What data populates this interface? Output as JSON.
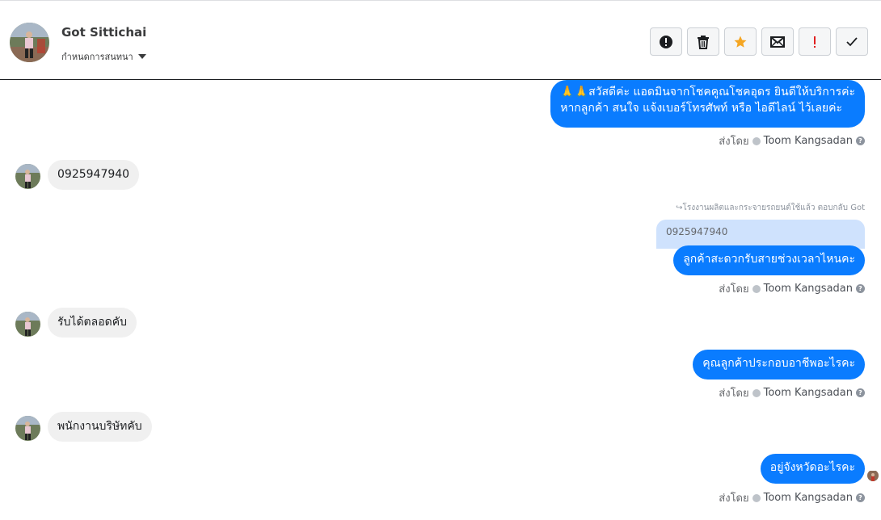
{
  "header": {
    "contact_name": "Got Sittichai",
    "assign_label": "กำหนดการสนทนา"
  },
  "toolbar": {
    "buttons": [
      {
        "name": "alert-circle",
        "icon": "alert-circle-icon"
      },
      {
        "name": "trash",
        "icon": "trash-icon"
      },
      {
        "name": "star",
        "icon": "star-icon",
        "color": "#f5a623"
      },
      {
        "name": "mail",
        "icon": "mail-icon"
      },
      {
        "name": "important",
        "icon": "exclamation-icon",
        "color": "#e02020"
      },
      {
        "name": "done",
        "icon": "check-icon"
      }
    ]
  },
  "messages": {
    "m1_line1": "🙏🙏สวัสดีค่ะ แอดมินจากโชคคูณโชคอุดร ยินดีให้บริการค่ะ",
    "m1_line2": "หากลูกค้า สนใจ แจ้งเบอร์โทรศัพท์ หรือ ไอดีไลน์  ไว้เลยค่ะ",
    "m2": "0925947940",
    "reply_note": "↪โรงงานผลิตและกระจายรถยนต์ใช้แล้ว ตอบกลับ Got",
    "quoted": "0925947940",
    "m3": "ลูกค้าสะดวกรับสายช่วงเวลาไหนคะ",
    "m4": "รับได้ตลอดคับ",
    "m5": "คุณลูกค้าประกอบอาชีพอะไรคะ",
    "m6": "พนักงานบริษัทคับ",
    "m7": "อยู่จังหวัดอะไรคะ"
  },
  "sent_by": {
    "prefix": "ส่งโดย",
    "agent": "Toom Kangsadan",
    "help": "?"
  },
  "colors": {
    "outgoing_bubble": "#0a7cff",
    "incoming_bubble": "#f0f0f0",
    "quoted_bubble": "#cfe2fd"
  }
}
